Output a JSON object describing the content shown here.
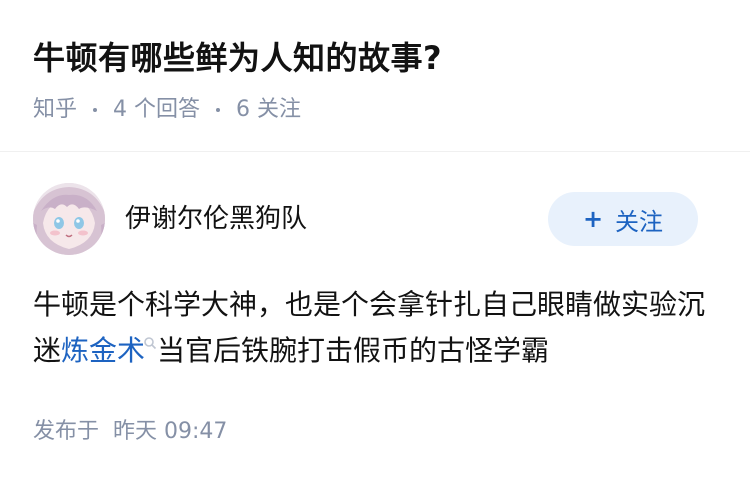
{
  "question": {
    "title": "牛顿有哪些鲜为人知的故事?"
  },
  "meta": {
    "source": "知乎",
    "answers": "4 个回答",
    "followers": "6 关注"
  },
  "author": {
    "name": "伊谢尔伦黑狗队",
    "avatar_icon": "anime-avatar-icon",
    "follow_label": "关注",
    "follow_plus": "+"
  },
  "answer": {
    "text_before": "牛顿是个科学大神，也是个会拿针扎自己眼睛做实验沉迷",
    "link_text": "炼金术",
    "text_after": "当官后铁腕打击假币的古怪学霸"
  },
  "footer": {
    "posted_label": "发布于",
    "posted_time": "昨天 09:47"
  },
  "colors": {
    "link": "#1d63c1",
    "meta": "#8590a6",
    "follow_bg": "#e8f1fc"
  }
}
